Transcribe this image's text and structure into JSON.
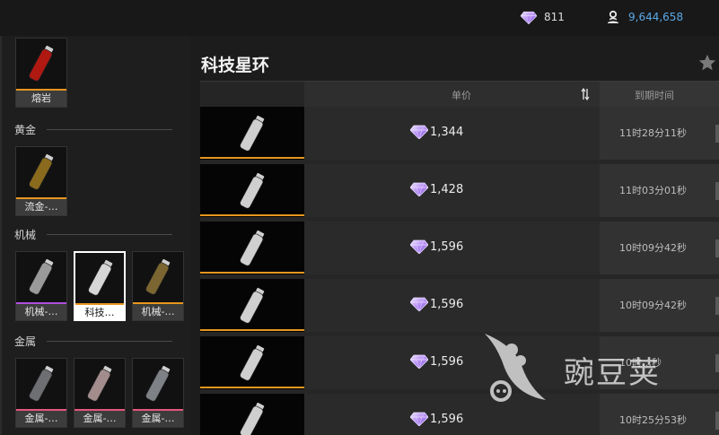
{
  "currency": {
    "gems": "811",
    "coins": "9,644,658",
    "gem_icon": "diamond-icon",
    "coin_icon": "coin-stack-icon"
  },
  "sidebar": {
    "sections": [
      {
        "heading": "",
        "items": [
          {
            "label": "熔岩",
            "bar_color": "#e8961d",
            "selected": false
          }
        ]
      },
      {
        "heading": "黄金",
        "items": [
          {
            "label": "流金-…",
            "bar_color": "#e8961d",
            "selected": false
          }
        ]
      },
      {
        "heading": "机械",
        "items": [
          {
            "label": "机械-…",
            "bar_color": "#b14fe0",
            "selected": false
          },
          {
            "label": "科技…",
            "bar_color": "#e8961d",
            "selected": true
          },
          {
            "label": "机械-…",
            "bar_color": "#e8961d",
            "selected": false
          }
        ]
      },
      {
        "heading": "金属",
        "items": [
          {
            "label": "金属-…",
            "bar_color": "#e8557d",
            "selected": false
          },
          {
            "label": "金属-…",
            "bar_color": "#e8557d",
            "selected": false
          },
          {
            "label": "金属-…",
            "bar_color": "#e8557d",
            "selected": false
          }
        ]
      }
    ]
  },
  "main": {
    "title": "科技星环",
    "headers": {
      "price": "单价",
      "expiry": "到期时间"
    },
    "rows": [
      {
        "price": "1,344",
        "expiry": "11时28分11秒"
      },
      {
        "price": "1,428",
        "expiry": "11时03分01秒"
      },
      {
        "price": "1,596",
        "expiry": "10时09分42秒"
      },
      {
        "price": "1,596",
        "expiry": "10时09分42秒"
      },
      {
        "price": "1,596",
        "expiry": "10时…秒"
      },
      {
        "price": "1,596",
        "expiry": "10时25分53秒"
      }
    ]
  },
  "watermark": {
    "text": "豌豆荚"
  },
  "colors": {
    "accent_orange": "#e8961d",
    "epic_purple": "#b14fe0",
    "rare_pink": "#e8557d",
    "coin_blue": "#5aa9e6"
  }
}
